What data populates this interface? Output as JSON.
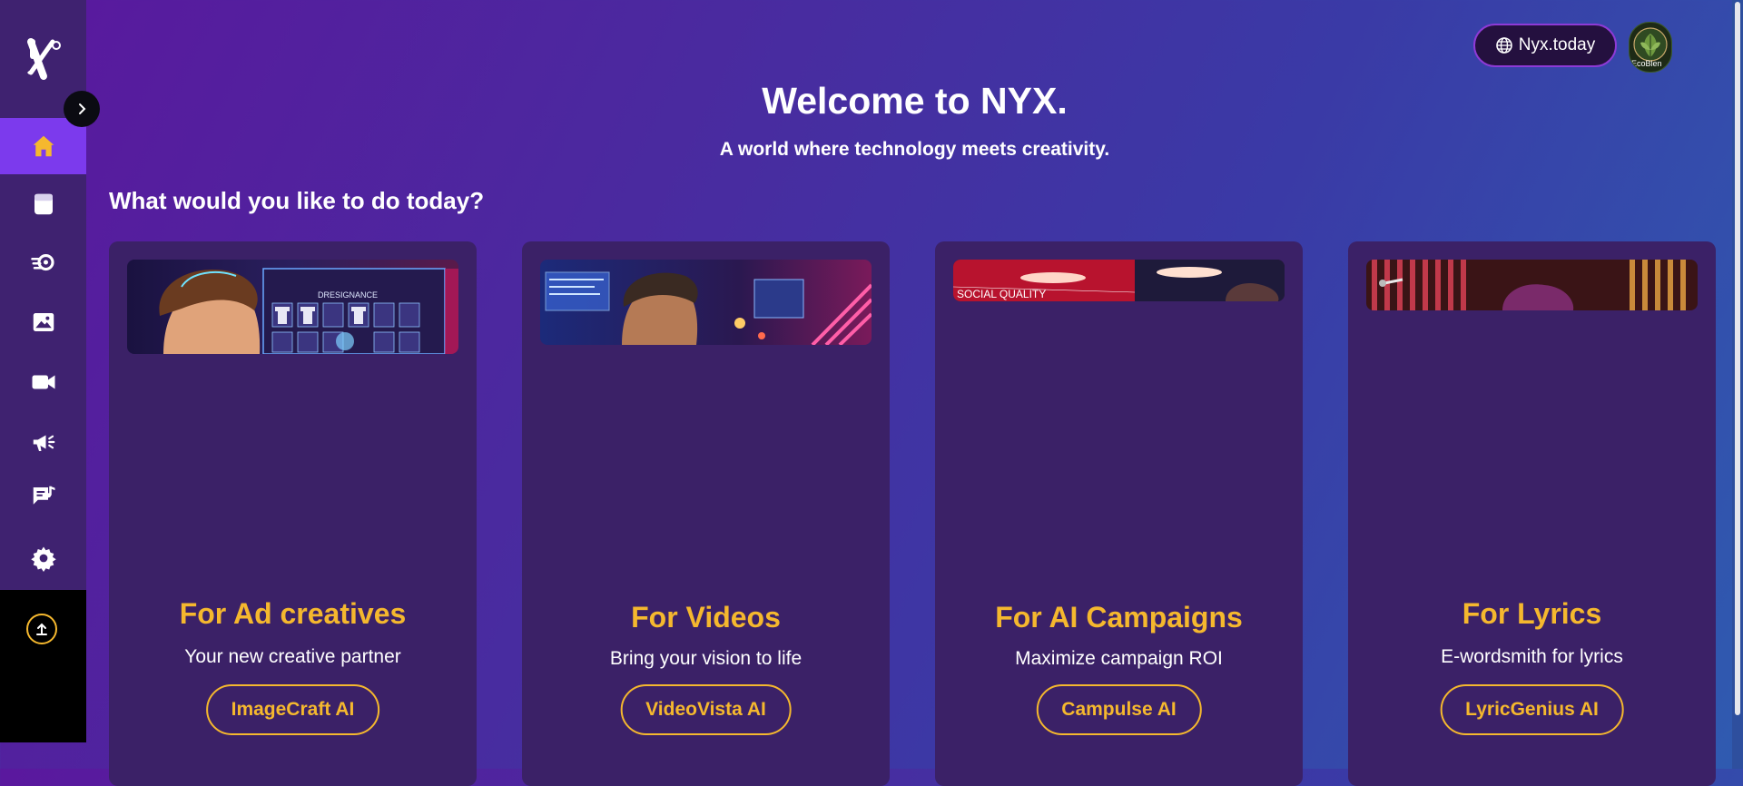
{
  "app": {
    "brand_icon": "nyx-logo-icon"
  },
  "sidebar": {
    "items": [
      {
        "name": "home",
        "icon": "home-icon",
        "active": true
      },
      {
        "name": "notes",
        "icon": "notepad-icon",
        "active": false
      },
      {
        "name": "ai-gear",
        "icon": "ai-gear-icon",
        "active": false
      },
      {
        "name": "images",
        "icon": "image-icon",
        "active": false
      },
      {
        "name": "videos",
        "icon": "video-camera-icon",
        "active": false
      },
      {
        "name": "campaigns",
        "icon": "megaphone-icon",
        "active": false
      },
      {
        "name": "lyrics",
        "icon": "lyrics-icon",
        "active": false
      },
      {
        "name": "settings",
        "icon": "gear-icon",
        "active": false
      }
    ],
    "upload_icon": "upload-icon",
    "collapse_icon": "chevron-right-icon"
  },
  "header": {
    "site_link": "Nyx.today",
    "site_icon": "globe-icon",
    "avatar_text": "EcoBlen"
  },
  "hero": {
    "title": "Welcome to NYX.",
    "tagline": "A world where technology meets creativity."
  },
  "main": {
    "question": "What would you like to do today?",
    "cards": [
      {
        "title": "For Ad creatives",
        "subtitle": "Your new creative partner",
        "button": "ImageCraft AI",
        "image_text": "DRESIGNANCE"
      },
      {
        "title": "For Videos",
        "subtitle": "Bring your vision to life",
        "button": "VideoVista AI"
      },
      {
        "title": "For AI Campaigns",
        "subtitle": "Maximize campaign ROI",
        "button": "Campulse AI",
        "image_text": "SOCIAL QUALITY"
      },
      {
        "title": "For Lyrics",
        "subtitle": "E-wordsmith for lyrics",
        "button": "LyricGenius AI"
      }
    ]
  },
  "colors": {
    "accent": "#f5b82e",
    "active_nav": "#7c3aed",
    "sidebar": "#3f2270",
    "card": "#3b2167"
  }
}
